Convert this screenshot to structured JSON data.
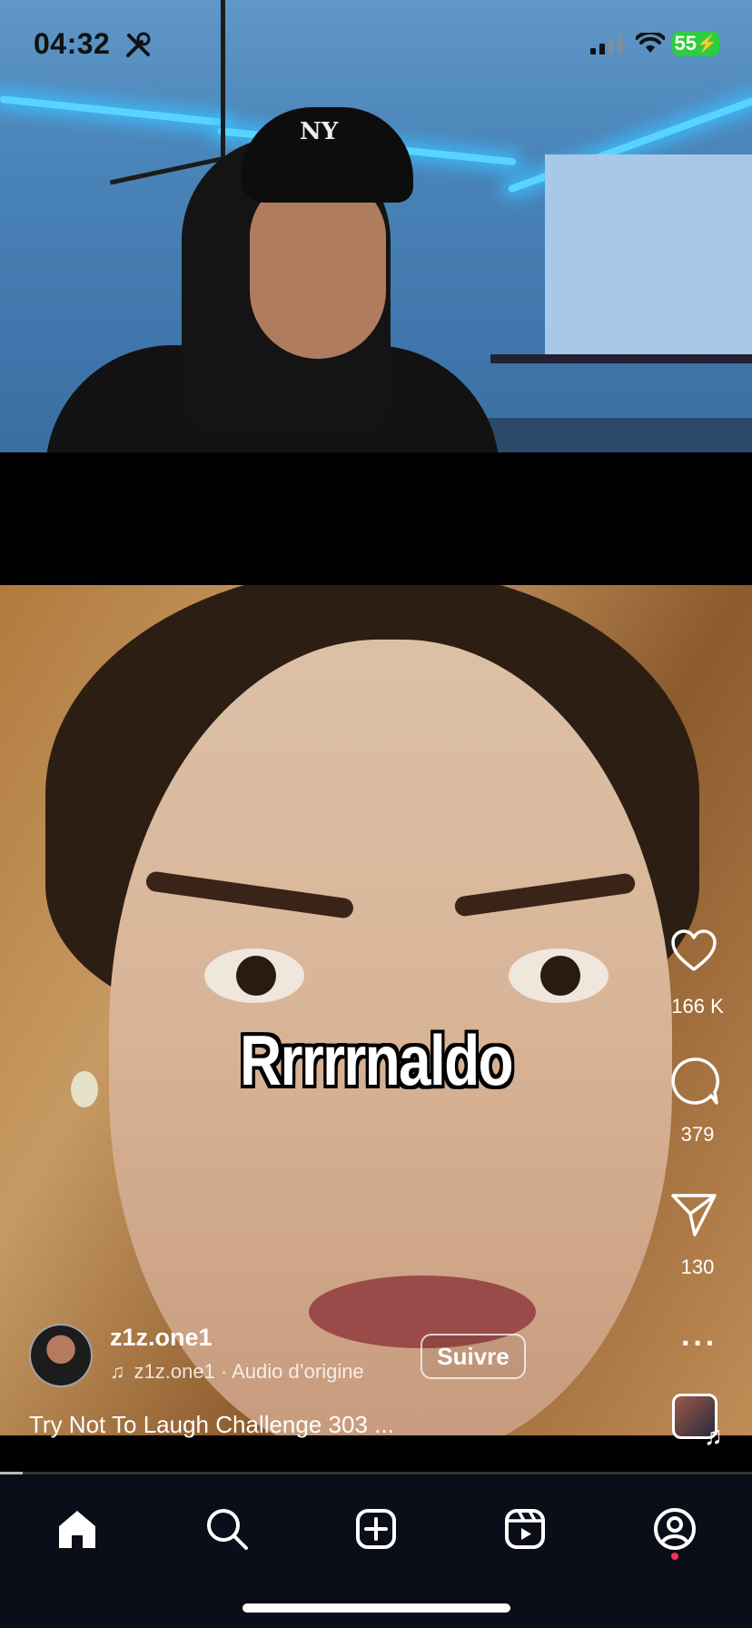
{
  "status_bar": {
    "time": "04:32",
    "battery": "55",
    "icons": [
      "tools-icon",
      "signal-icon",
      "wifi-icon",
      "battery-icon"
    ]
  },
  "overlay_caption": "Rrrrrnaldo",
  "actions": {
    "likes": "166 K",
    "comments": "379",
    "shares": "130"
  },
  "post": {
    "username": "z1z.one1",
    "audio": "z1z.one1 · Audio d’origine",
    "follow_label": "Suivre",
    "description": "Try Not To Laugh Challenge 303 ..."
  },
  "playback": {
    "progress_fraction": 0.03
  },
  "nav": {
    "items": [
      "home-icon",
      "search-icon",
      "create-icon",
      "reels-icon",
      "profile-icon"
    ],
    "active": "home-icon",
    "notification_color": "#ff2d55"
  },
  "colors": {
    "led": "#58d5ff",
    "nav_bg": "#0b0e18",
    "battery": "#2ecc40"
  }
}
